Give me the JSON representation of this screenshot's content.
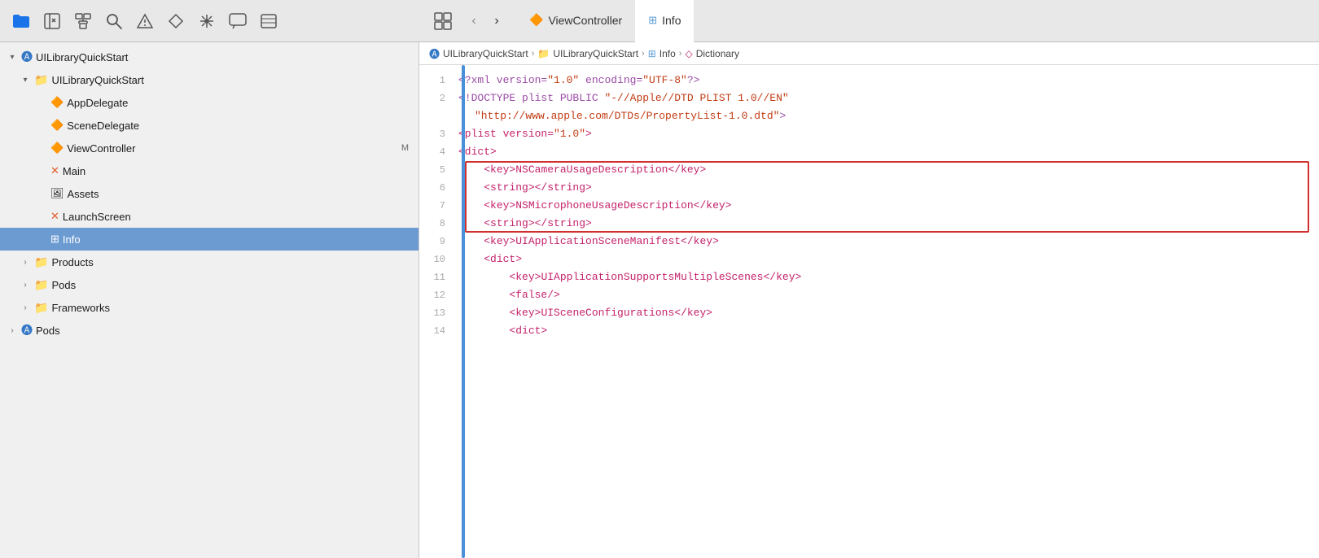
{
  "toolbar": {
    "left_icons": [
      {
        "name": "folder-icon",
        "symbol": "📁",
        "color": "#1a73e8"
      },
      {
        "name": "close-icon",
        "symbol": "✕"
      },
      {
        "name": "hierarchy-icon",
        "symbol": "⊞"
      },
      {
        "name": "search-icon",
        "symbol": "🔍"
      },
      {
        "name": "warning-icon",
        "symbol": "△"
      },
      {
        "name": "diamond-icon",
        "symbol": "◇"
      },
      {
        "name": "grid-star-icon",
        "symbol": "✳"
      },
      {
        "name": "bubble-icon",
        "symbol": "⬭"
      },
      {
        "name": "list-icon",
        "symbol": "☰"
      }
    ],
    "right_icons": [
      {
        "name": "grid-view-icon",
        "symbol": "⊞"
      }
    ],
    "tabs": [
      {
        "label": "ViewController",
        "icon": "swift",
        "active": false
      },
      {
        "label": "Info",
        "icon": "table",
        "active": true
      }
    ]
  },
  "breadcrumb": {
    "items": [
      {
        "label": "UILibraryQuickStart",
        "icon": "app"
      },
      {
        "label": "UILibraryQuickStart",
        "icon": "folder"
      },
      {
        "label": "Info",
        "icon": "table"
      },
      {
        "label": "Dictionary",
        "icon": "code"
      }
    ]
  },
  "sidebar": {
    "project_name": "UILibraryQuickStart",
    "items": [
      {
        "id": "root",
        "label": "UILibraryQuickStart",
        "icon": "swift-app",
        "indent": 0,
        "disclosure": "open"
      },
      {
        "id": "group1",
        "label": "UILibraryQuickStart",
        "icon": "folder",
        "indent": 1,
        "disclosure": "open"
      },
      {
        "id": "appdelegate",
        "label": "AppDelegate",
        "icon": "swift",
        "indent": 2,
        "disclosure": "none"
      },
      {
        "id": "scenedelegate",
        "label": "SceneDelegate",
        "icon": "swift",
        "indent": 2,
        "disclosure": "none"
      },
      {
        "id": "viewcontroller",
        "label": "ViewController",
        "icon": "swift",
        "indent": 2,
        "disclosure": "none",
        "badge": "M"
      },
      {
        "id": "main",
        "label": "Main",
        "icon": "storyboard",
        "indent": 2,
        "disclosure": "none"
      },
      {
        "id": "assets",
        "label": "Assets",
        "icon": "assets",
        "indent": 2,
        "disclosure": "none"
      },
      {
        "id": "launchscreen",
        "label": "LaunchScreen",
        "icon": "storyboard",
        "indent": 2,
        "disclosure": "none"
      },
      {
        "id": "info",
        "label": "Info",
        "icon": "table",
        "indent": 2,
        "disclosure": "none",
        "selected": true
      },
      {
        "id": "products",
        "label": "Products",
        "icon": "folder",
        "indent": 1,
        "disclosure": "closed"
      },
      {
        "id": "pods",
        "label": "Pods",
        "icon": "folder",
        "indent": 1,
        "disclosure": "closed"
      },
      {
        "id": "frameworks",
        "label": "Frameworks",
        "icon": "folder",
        "indent": 1,
        "disclosure": "closed"
      },
      {
        "id": "pods2",
        "label": "Pods",
        "icon": "swift-app",
        "indent": 0,
        "disclosure": "closed"
      }
    ]
  },
  "editor": {
    "lines": [
      {
        "num": 1,
        "content": "<?xml version=\"1.0\" encoding=\"UTF-8\"?>",
        "type": "xml-pi"
      },
      {
        "num": 2,
        "content": "<!DOCTYPE plist PUBLIC \"-//Apple//DTD PLIST 1.0//EN\"\n\t\"http://www.apple.com/DTDs/PropertyList-1.0.dtd\">",
        "type": "doctype"
      },
      {
        "num": 3,
        "content": "<plist version=\"1.0\">",
        "type": "tag"
      },
      {
        "num": 4,
        "content": "<dict>",
        "type": "tag"
      },
      {
        "num": 5,
        "content": "\t<key>NSCameraUsageDescription</key>",
        "type": "tag",
        "highlight": true
      },
      {
        "num": 6,
        "content": "\t<string></string>",
        "type": "tag",
        "highlight": true
      },
      {
        "num": 7,
        "content": "\t<key>NSMicrophoneUsageDescription</key>",
        "type": "tag",
        "highlight": true
      },
      {
        "num": 8,
        "content": "\t<string></string>",
        "type": "tag",
        "highlight": true
      },
      {
        "num": 9,
        "content": "\t<key>UIApplicationSceneManifest</key>",
        "type": "tag"
      },
      {
        "num": 10,
        "content": "\t<dict>",
        "type": "tag"
      },
      {
        "num": 11,
        "content": "\t\t<key>UIApplicationSupportsMultipleScenes</key>",
        "type": "tag"
      },
      {
        "num": 12,
        "content": "\t\t<false/>",
        "type": "tag"
      },
      {
        "num": 13,
        "content": "\t\t<key>UISceneConfigurations</key>",
        "type": "tag"
      },
      {
        "num": 14,
        "content": "\t\t<dict>",
        "type": "tag"
      }
    ]
  }
}
